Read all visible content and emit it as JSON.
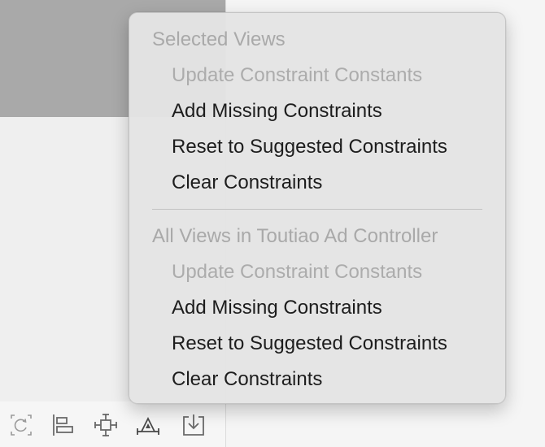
{
  "menu": {
    "section1": {
      "header": "Selected Views",
      "items": [
        {
          "label": "Update Constraint Constants",
          "enabled": false
        },
        {
          "label": "Add Missing Constraints",
          "enabled": true
        },
        {
          "label": "Reset to Suggested Constraints",
          "enabled": true
        },
        {
          "label": "Clear Constraints",
          "enabled": true
        }
      ]
    },
    "section2": {
      "header": "All Views in Toutiao Ad Controller",
      "items": [
        {
          "label": "Update Constraint Constants",
          "enabled": false
        },
        {
          "label": "Add Missing Constraints",
          "enabled": true
        },
        {
          "label": "Reset to Suggested Constraints",
          "enabled": true
        },
        {
          "label": "Clear Constraints",
          "enabled": true
        }
      ]
    }
  },
  "toolbar": {
    "icons": [
      "update-frames-icon",
      "align-icon",
      "add-constraints-icon",
      "resolve-issues-icon",
      "embed-in-icon"
    ]
  },
  "colors": {
    "menu_bg": "#e4e4e4",
    "disabled_text": "#acacac",
    "enabled_text": "#1d1d1d",
    "canvas_gray_view": "#a9a9a9"
  }
}
